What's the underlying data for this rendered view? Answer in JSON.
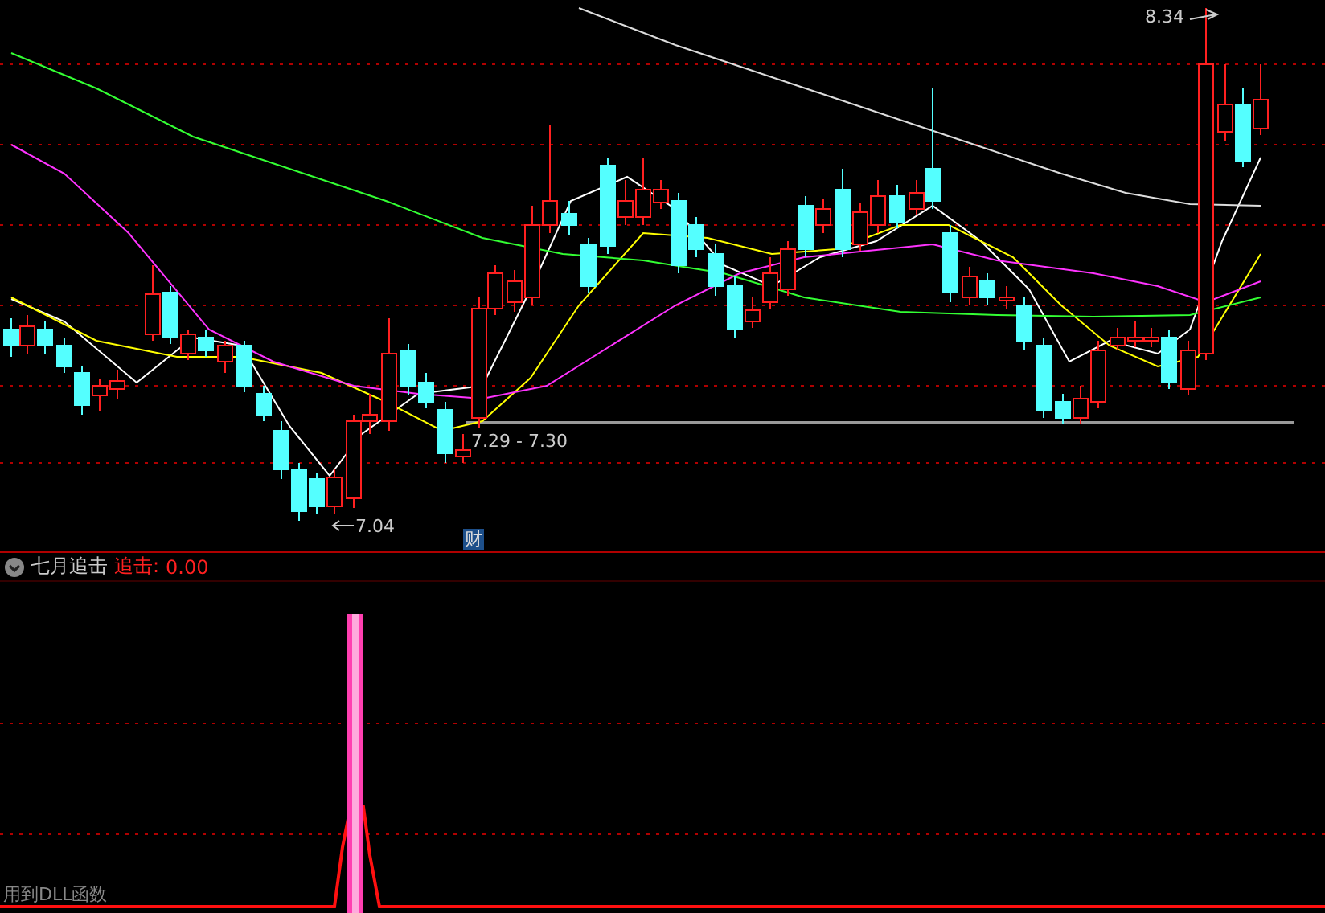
{
  "main_chart": {
    "labels": [
      {
        "kind": "high",
        "text": "8.34"
      },
      {
        "kind": "low",
        "text": "7.04"
      },
      {
        "kind": "range",
        "text": "7.29 - 7.30"
      }
    ],
    "finance_badge": "财"
  },
  "indicator": {
    "name": "七月追击",
    "output_label": "追击:",
    "output_value": "0.00"
  },
  "footer_note": "用到DLL函数"
}
